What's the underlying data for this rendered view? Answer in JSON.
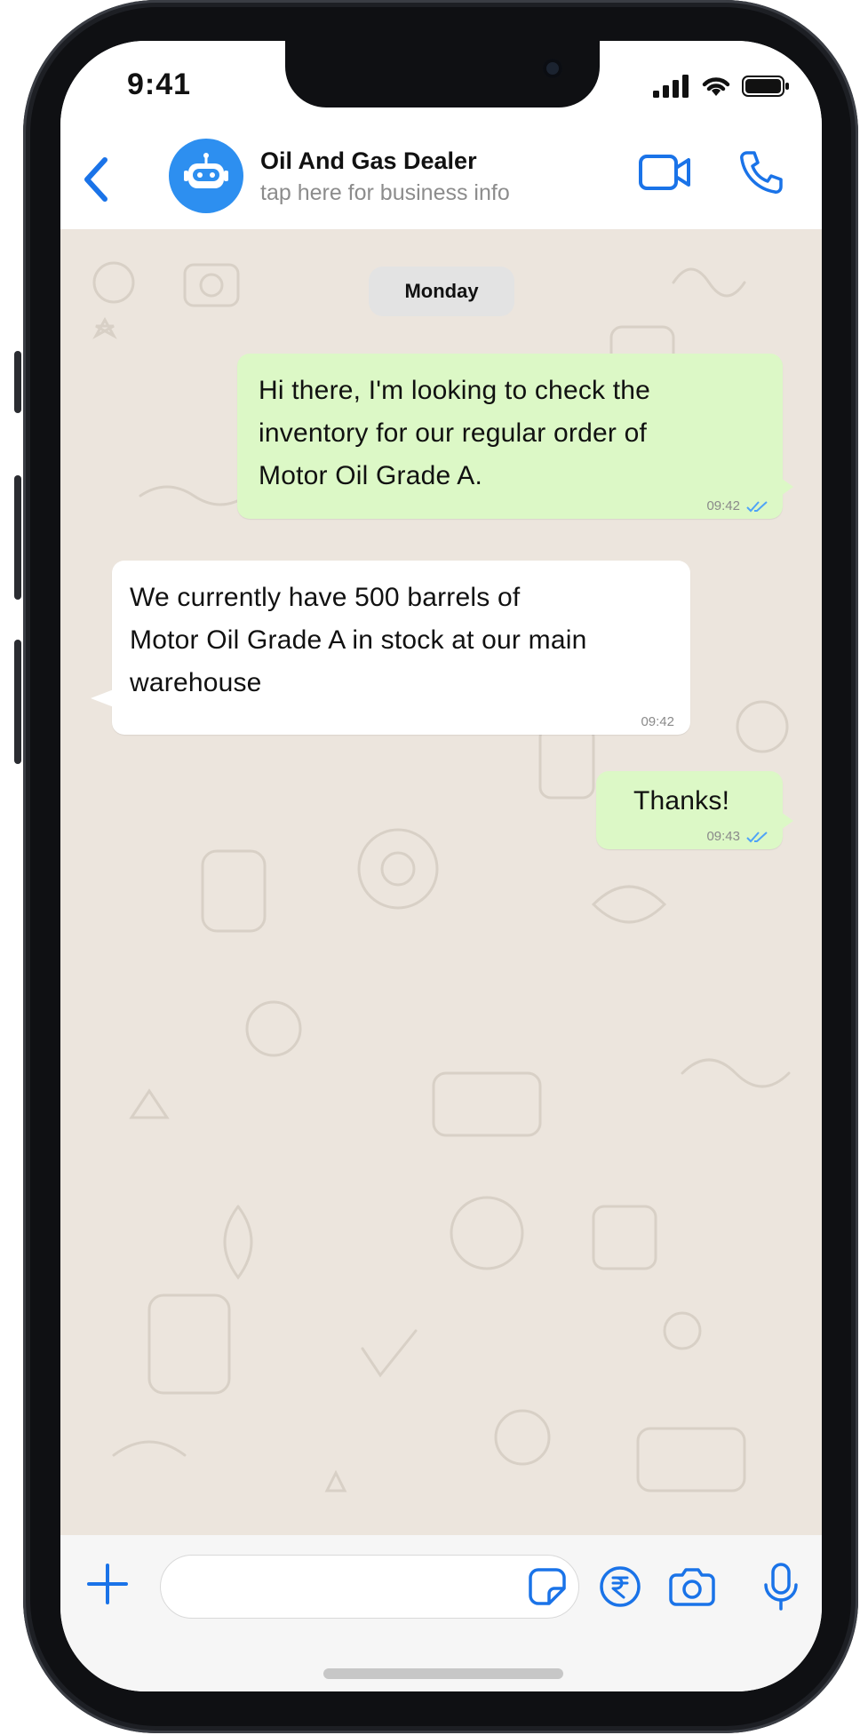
{
  "status_bar": {
    "time": "9:41"
  },
  "header": {
    "contact_name": "Oil And Gas Dealer",
    "contact_subtitle": "tap here for business info"
  },
  "chat": {
    "day_label": "Monday",
    "messages": [
      {
        "direction": "outgoing",
        "lines": [
          "Hi there, I'm looking to check the",
          "inventory for our regular order of",
          "Motor Oil Grade A."
        ],
        "time": "09:42",
        "read": true
      },
      {
        "direction": "incoming",
        "lines": [
          "We currently have 500 barrels of",
          "Motor Oil Grade A in stock at our main",
          "warehouse"
        ],
        "time": "09:42"
      },
      {
        "direction": "outgoing",
        "lines": [
          "Thanks!"
        ],
        "time": "09:43",
        "read": true
      }
    ]
  },
  "input_bar": {
    "icons": [
      "plus-icon",
      "sticker-icon",
      "rupee-payment-icon",
      "camera-icon",
      "microphone-icon"
    ]
  },
  "colors": {
    "accent": "#1a73e8",
    "avatar": "#2d8ff0",
    "outgoing_bubble": "#dcf8c6",
    "incoming_bubble": "#ffffff",
    "chat_background": "#ece5dd",
    "read_ticks": "#4fa3f7"
  }
}
